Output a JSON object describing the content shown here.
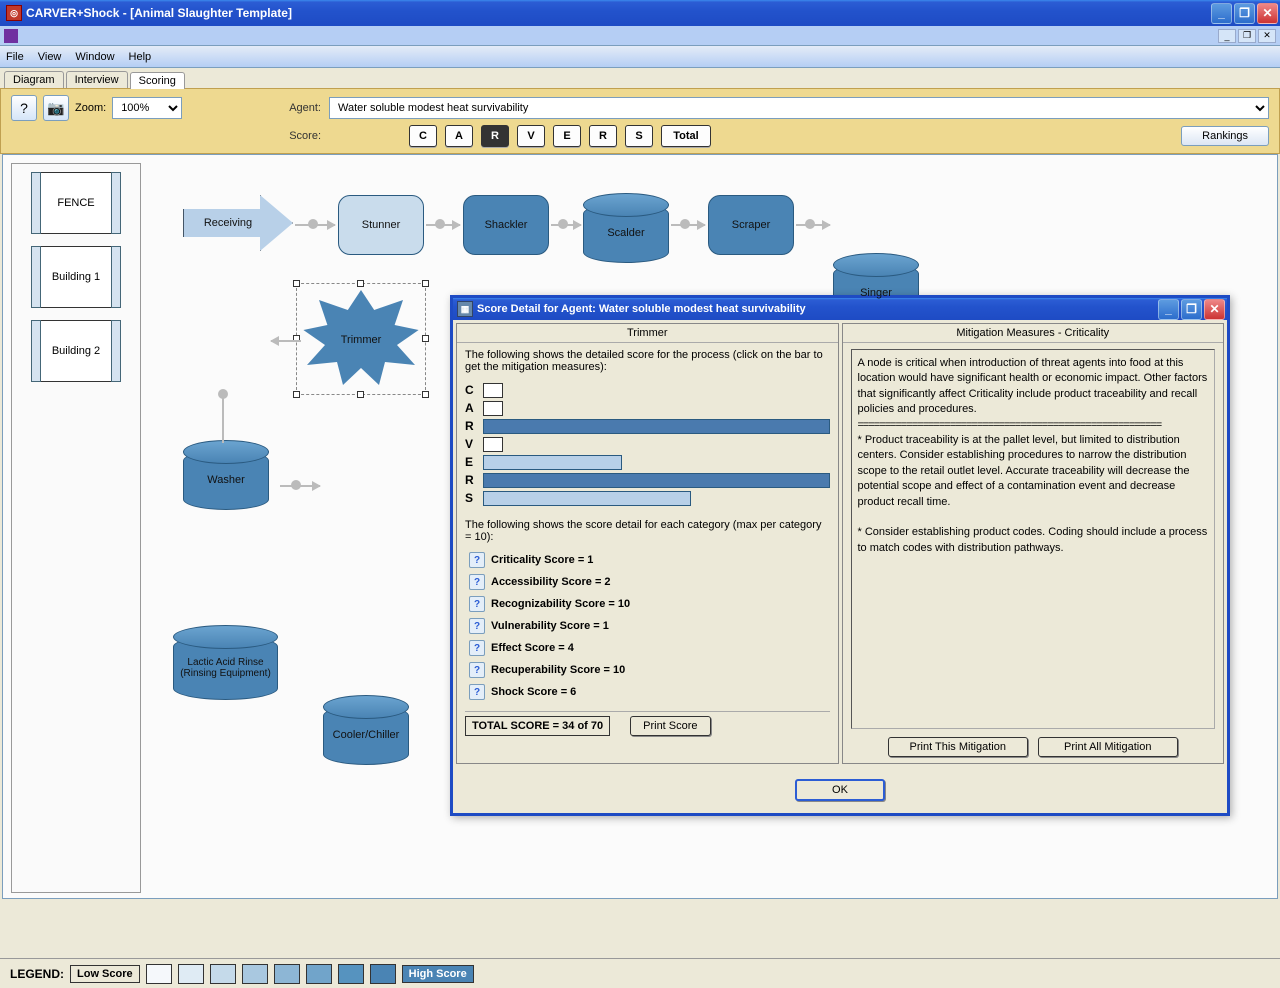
{
  "titlebar": {
    "title": "CARVER+Shock - [Animal Slaughter Template]"
  },
  "menu": {
    "file": "File",
    "view": "View",
    "window": "Window",
    "help": "Help"
  },
  "tabs": {
    "diagram": "Diagram",
    "interview": "Interview",
    "scoring": "Scoring"
  },
  "toolbar": {
    "zoom_label": "Zoom:",
    "zoom_value": "100%",
    "agent_label": "Agent:",
    "agent_value": "Water soluble modest heat survivability",
    "score_label": "Score:",
    "buttons": {
      "c": "C",
      "a": "A",
      "r": "R",
      "v": "V",
      "e": "E",
      "r2": "R",
      "s": "S",
      "total": "Total"
    },
    "rankings": "Rankings"
  },
  "sidebar": {
    "fence": "FENCE",
    "b1": "Building 1",
    "b2": "Building 2"
  },
  "nodes": {
    "receiving": "Receiving",
    "stunner": "Stunner",
    "shackler": "Shackler",
    "scalder": "Scalder",
    "scraper": "Scraper",
    "singer": "Singer",
    "washer": "Washer",
    "trimmer": "Trimmer",
    "lactic": "Lactic Acid Rinse (Rinsing Equipment)",
    "cooler": "Cooler/Chiller"
  },
  "dialog": {
    "title": "Score Detail for Agent:  Water soluble modest heat survivability",
    "left_title": "Trimmer",
    "chart_note": "The following shows the detailed score for the process (click on the bar to get the mitigation measures):",
    "list_note": "The following shows the score detail for each category (max per category = 10):",
    "scores": {
      "c": "Criticality Score = 1",
      "a": "Accessibility Score = 2",
      "r": "Recognizability Score = 10",
      "v": "Vulnerability Score = 1",
      "e": "Effect Score = 4",
      "rr": "Recuperability Score = 10",
      "s": "Shock Score = 6"
    },
    "total": "TOTAL SCORE = 34 of 70",
    "print_score": "Print Score",
    "right_title": "Mitigation Measures - Criticality",
    "mitigation_intro": "A node is critical when introduction of threat agents into food at this location would have significant health or economic impact.  Other factors that significantly affect Criticality include product traceability and recall policies and procedures.",
    "mitigation_sep": "========================================================",
    "mitigation_p1": "  * Product traceability is at the pallet level, but limited to distribution centers.  Consider establishing procedures to narrow the distribution scope to the retail outlet level. Accurate traceability will decrease the potential scope and effect of a contamination event and decrease product recall time.",
    "mitigation_p2": "  * Consider establishing product codes.  Coding should include a process to match codes with distribution pathways.",
    "print_this": "Print This Mitigation",
    "print_all": "Print All Mitigation",
    "ok": "OK"
  },
  "legend": {
    "label": "LEGEND:",
    "low": "Low Score",
    "high": "High Score"
  },
  "chart_data": {
    "type": "bar",
    "title": "Trimmer",
    "categories": [
      "C",
      "A",
      "R",
      "V",
      "E",
      "R",
      "S"
    ],
    "values": [
      1,
      2,
      10,
      1,
      4,
      10,
      6
    ],
    "ylim": [
      0,
      10
    ],
    "total": 34,
    "total_max": 70
  }
}
